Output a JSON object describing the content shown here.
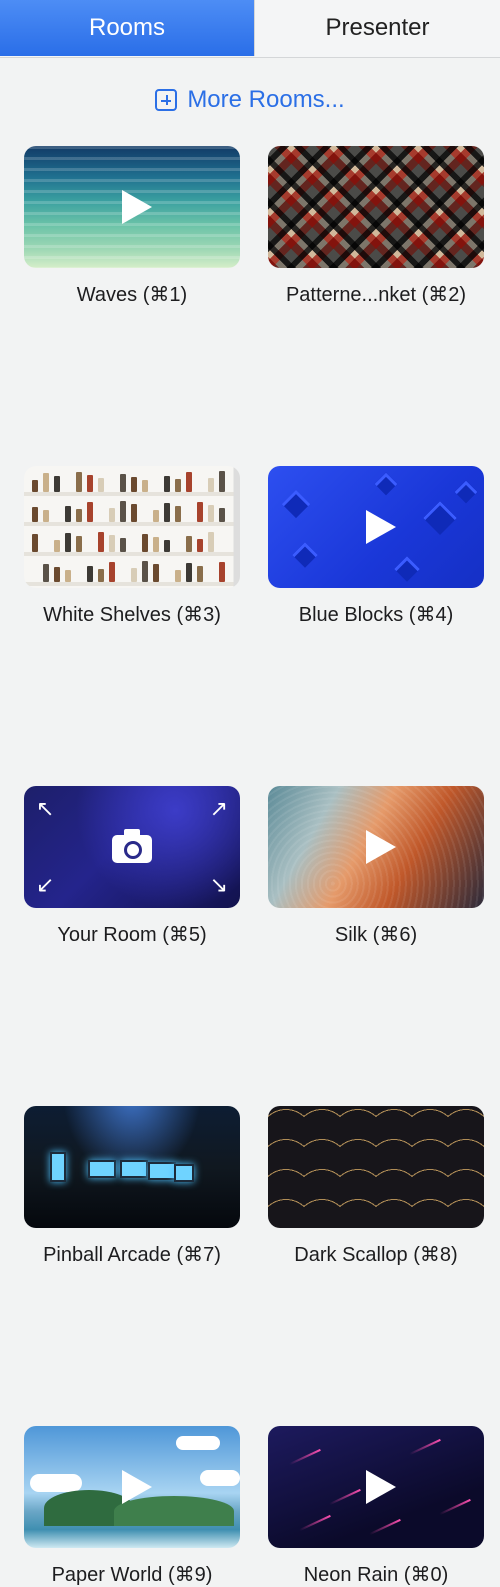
{
  "tabs": {
    "rooms": "Rooms",
    "presenter": "Presenter"
  },
  "more_rooms": "More Rooms...",
  "rooms": [
    {
      "label": "Waves (⌘1)",
      "style": "waves",
      "play": true
    },
    {
      "label": "Patterne...nket (⌘2)",
      "style": "pattern",
      "play": false
    },
    {
      "label": "White Shelves (⌘3)",
      "style": "shelves",
      "play": false
    },
    {
      "label": "Blue Blocks (⌘4)",
      "style": "blocks",
      "play": true
    },
    {
      "label": "Your Room (⌘5)",
      "style": "yourroom",
      "play": false
    },
    {
      "label": "Silk (⌘6)",
      "style": "silk",
      "play": true
    },
    {
      "label": "Pinball Arcade (⌘7)",
      "style": "arcade",
      "play": false
    },
    {
      "label": "Dark Scallop (⌘8)",
      "style": "scallop",
      "play": false
    },
    {
      "label": "Paper World (⌘9)",
      "style": "paper",
      "play": true
    },
    {
      "label": "Neon Rain (⌘0)",
      "style": "neon",
      "play": true
    }
  ],
  "colors": {
    "accent": "#2b6fe6",
    "tab_active": "#3a7cf0"
  },
  "icons": {
    "more": "plus-square-icon",
    "play": "play-icon",
    "camera": "camera-icon",
    "expand": "expand-corners-icon"
  }
}
